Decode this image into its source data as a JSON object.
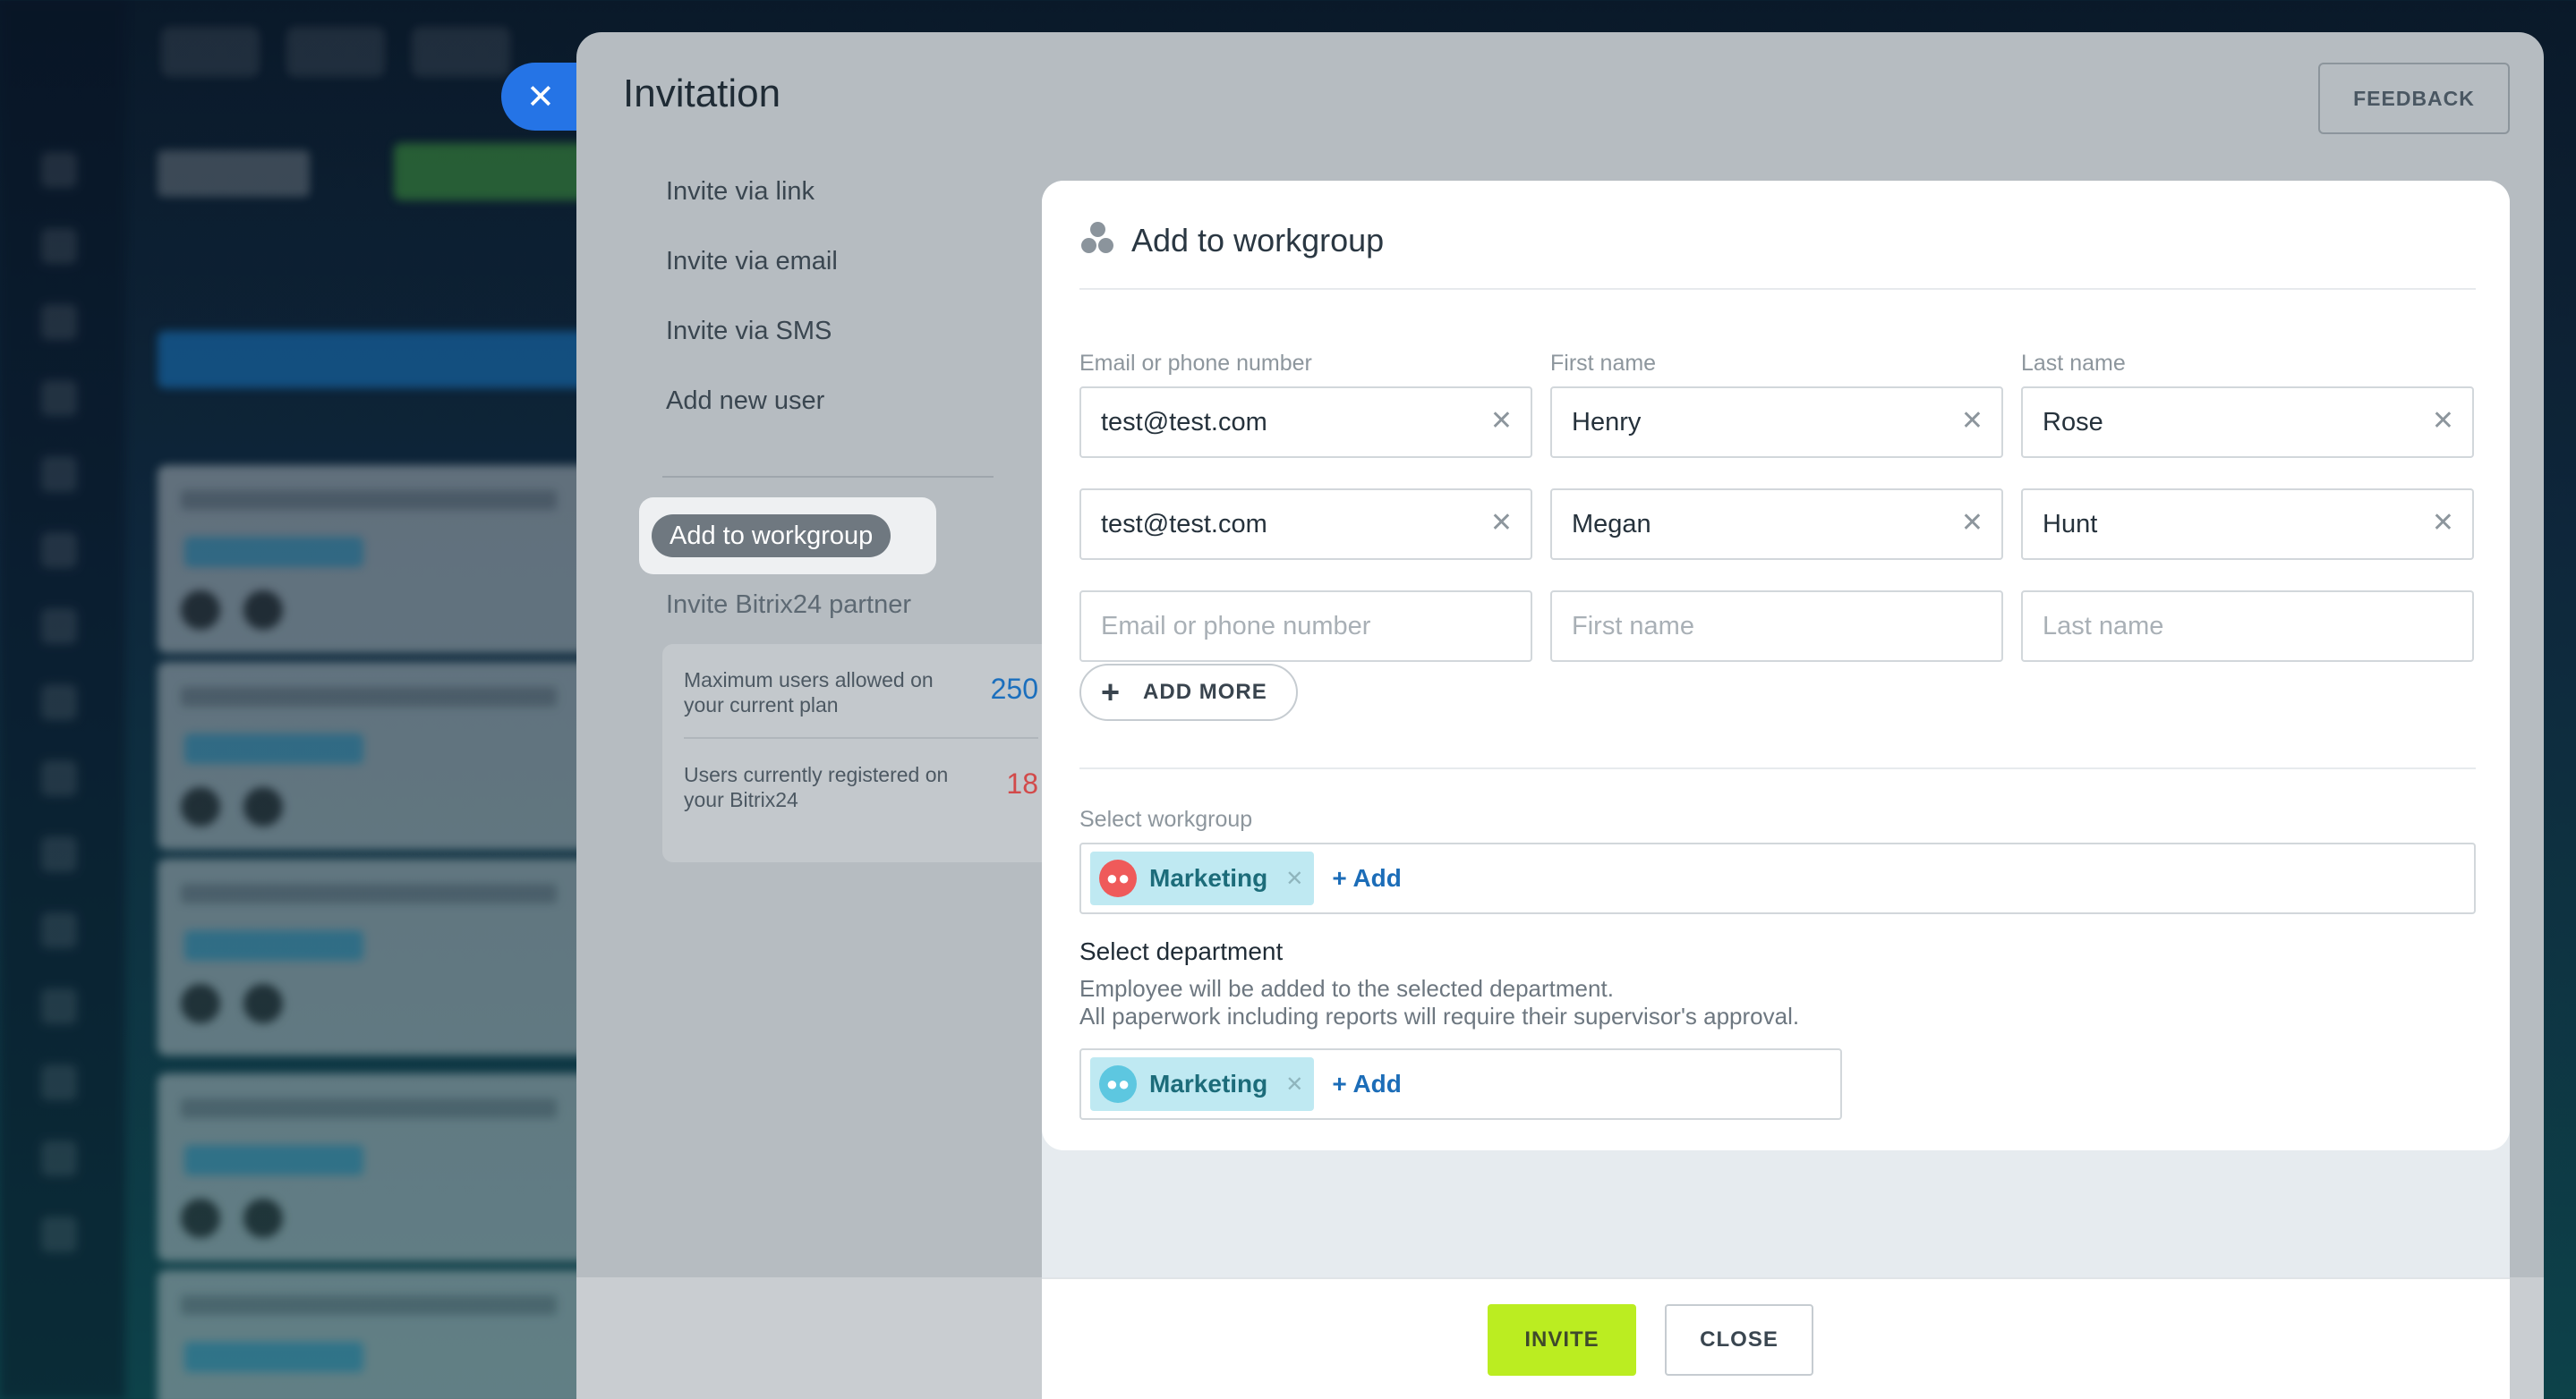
{
  "panel": {
    "title": "Invitation",
    "feedback_label": "FEEDBACK",
    "close_icon": "close-icon"
  },
  "menu": {
    "items": [
      {
        "label": "Invite via link"
      },
      {
        "label": "Invite via email"
      },
      {
        "label": "Invite via SMS"
      },
      {
        "label": "Add new user"
      }
    ],
    "active": {
      "label": "Add to workgroup"
    },
    "partner": {
      "label": "Invite Bitrix24 partner"
    }
  },
  "limits": {
    "max_users": {
      "label": "Maximum users allowed on your current plan",
      "value": "250"
    },
    "registered": {
      "label": "Users currently registered on your Bitrix24",
      "value": "18"
    }
  },
  "form": {
    "title": "Add to workgroup",
    "columns": {
      "email": "Email or phone number",
      "first": "First name",
      "last": "Last name"
    },
    "rows": [
      {
        "email": "test@test.com",
        "first": "Henry",
        "last": "Rose"
      },
      {
        "email": "test@test.com",
        "first": "Megan",
        "last": "Hunt"
      }
    ],
    "placeholders": {
      "email": "Email or phone number",
      "first": "First name",
      "last": "Last name"
    },
    "add_more_label": "ADD MORE",
    "workgroup": {
      "label": "Select workgroup",
      "selected": "Marketing",
      "add_label": "+ Add"
    },
    "department": {
      "title": "Select department",
      "desc_line1": "Employee will be added to the selected department.",
      "desc_line2": "All paperwork including reports will require their supervisor's approval.",
      "selected": "Marketing",
      "add_label": "+ Add"
    }
  },
  "footer": {
    "invite_label": "INVITE",
    "close_label": "CLOSE"
  },
  "colors": {
    "accent_green": "#bbed21",
    "link_blue": "#1c6db8",
    "limit_blue": "#1b6fbd",
    "limit_red": "#d24a4a",
    "close_tab_blue": "#2574e6"
  }
}
